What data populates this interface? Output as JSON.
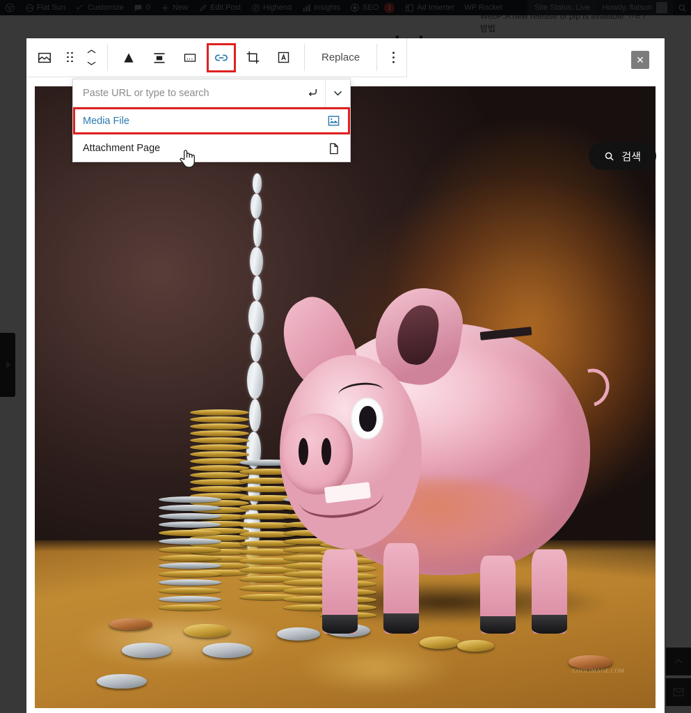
{
  "adminbar": {
    "items": [
      {
        "icon": "wordpress-logo-icon",
        "label": ""
      },
      {
        "icon": "home-icon",
        "label": "Flat Sun"
      },
      {
        "icon": "brush-icon",
        "label": "Customize"
      },
      {
        "icon": "comment-icon",
        "label": "0"
      },
      {
        "icon": "plus-icon",
        "label": "New"
      },
      {
        "icon": "pencil-icon",
        "label": "Edit Post"
      },
      {
        "icon": "highend-icon",
        "label": "Highend"
      },
      {
        "icon": "bars-chart-icon",
        "label": "Insights"
      },
      {
        "icon": "seo-icon",
        "label": "SEO",
        "badge": "1"
      },
      {
        "icon": "ad-inserter-icon",
        "label": "Ad Inserter"
      },
      {
        "icon": "",
        "label": "WP Rocket"
      }
    ],
    "site_status": "Site Status: Live",
    "howdy": "Howdy, flatsun",
    "search_icon": "search-icon"
  },
  "behind": {
    "notice": "WebP:A new release of pip is available ㄲㄹ?",
    "notice_sub": "방법",
    "post_title": "ㄱㅣㅣㅇㅡ"
  },
  "toolbar": {
    "buttons": [
      {
        "name": "image-block-icon",
        "label": "",
        "icon": "image-icon"
      },
      {
        "name": "drag-handle",
        "label": "",
        "icon": "drag-dots-icon"
      },
      {
        "name": "move-updown",
        "label": "",
        "icon": "chevron-updown-icon"
      },
      {
        "name": "align-icon",
        "label": "",
        "icon": "triangle-align-icon"
      },
      {
        "name": "align-text-center",
        "label": "",
        "icon": "align-center-icon"
      },
      {
        "name": "caption-button",
        "label": "",
        "icon": "caption-icon"
      },
      {
        "name": "link-button",
        "label": "",
        "icon": "link-icon",
        "active": true
      },
      {
        "name": "crop-button",
        "label": "",
        "icon": "crop-icon"
      },
      {
        "name": "add-text-over-image",
        "label": "",
        "icon": "text-over-image-icon"
      }
    ],
    "replace_label": "Replace",
    "more_options_label": "",
    "close_label": "✕"
  },
  "link_popover": {
    "url_placeholder": "Paste URL or type to search",
    "url_value": "",
    "submit_icon": "return-arrow-icon",
    "expand_icon": "chevron-down-icon",
    "options": [
      {
        "label": "Media File",
        "icon": "media-file-icon",
        "selected": true
      },
      {
        "label": "Attachment Page",
        "icon": "page-document-icon",
        "selected": false
      }
    ]
  },
  "search_pill": {
    "label": "검색",
    "icon": "search-icon"
  },
  "image": {
    "alt": "Oil painting of a pink piggy bank beside stacks of gold and silver coins with a stream of coins pouring down",
    "signature": "COOLIMAGE.COM"
  },
  "dock": {
    "buttons": [
      {
        "name": "scroll-to-top-button",
        "icon": "chevron-up-icon"
      },
      {
        "name": "contact-email-button",
        "icon": "envelope-icon"
      }
    ]
  },
  "colors": {
    "accent_link": "#2a7ab0",
    "highlight_red": "#e02020",
    "adminbar_bg": "#1d2327",
    "badge_red": "#d63638"
  }
}
